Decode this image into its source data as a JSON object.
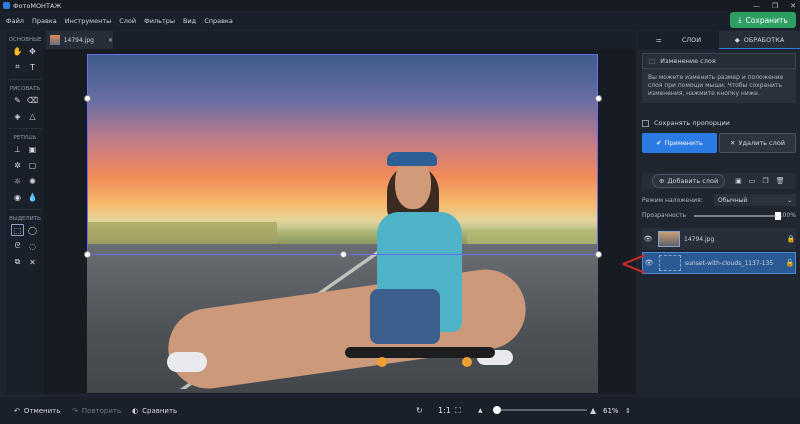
{
  "window": {
    "title": "ФотоМОНТАЖ",
    "min": "—",
    "max": "❐",
    "close": "✕"
  },
  "menu": [
    "Файл",
    "Правка",
    "Инструменты",
    "Слой",
    "Фильтры",
    "Вид",
    "Справка"
  ],
  "save_button": "Сохранить",
  "toolbar": {
    "sections": [
      "ОСНОВНЫЕ",
      "РИСОВАТЬ",
      "РЕТУШЬ",
      "ВЫДЕЛИТЬ"
    ]
  },
  "document_tab": {
    "name": "14794.jpg",
    "close": "×"
  },
  "panel": {
    "tabs": [
      "СЛОИ",
      "ОБРАБОТКА"
    ],
    "change_layer": "Изменение слоя",
    "info": "Вы можете изменить размер и положение слоя при помощи мыши. Чтобы сохранить изменения, нажмите кнопку ниже.",
    "keep_proportions": "Сохранять пропорции",
    "apply": "Применить",
    "delete_layer": "Удалить слой",
    "add_layer": "Добавить слой",
    "blend_label": "Режим наложения:",
    "blend_value": "Обычный",
    "opacity_label": "Прозрачность",
    "opacity_value": "100%",
    "layers": [
      {
        "name": "14794.jpg",
        "locked": true,
        "selected": false
      },
      {
        "name": "sunset-with-clouds_1137-135",
        "locked": false,
        "selected": true
      }
    ]
  },
  "status": {
    "undo": "Отменить",
    "redo": "Повторить",
    "compare": "Сравнить",
    "ratio": "1:1",
    "zoom": "61%",
    "zoom_fraction": 0.61
  },
  "colors": {
    "accent": "#2c7be5",
    "save": "#2e9f62",
    "selection": "#6e6cf0",
    "arrow": "#d12a2a"
  }
}
